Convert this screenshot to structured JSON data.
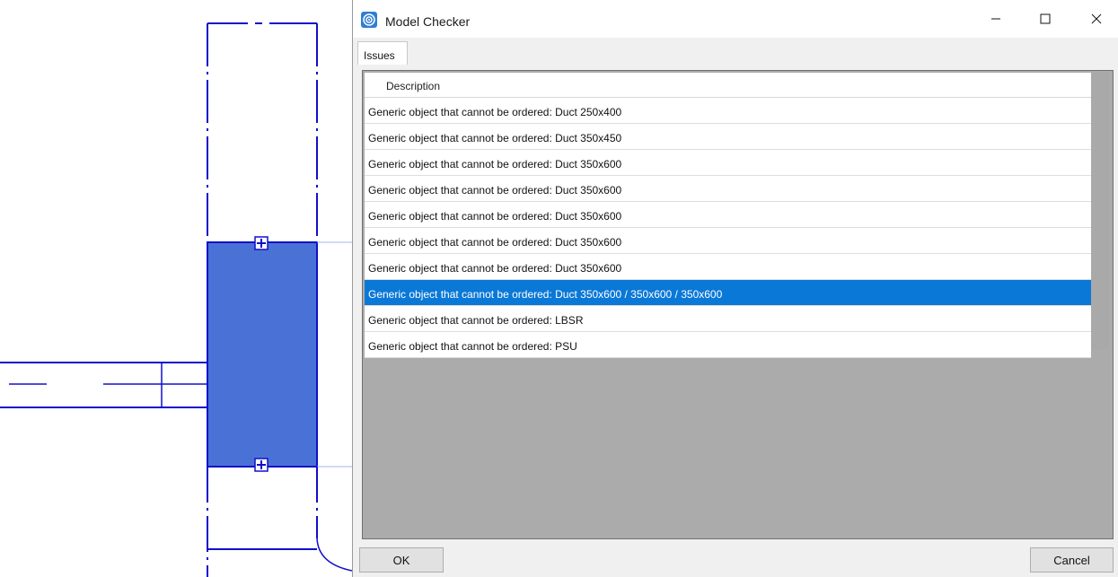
{
  "window": {
    "title": "Model Checker",
    "icon": "model-checker-app-icon",
    "controls": [
      "minimize-icon",
      "maximize-icon",
      "close-icon"
    ]
  },
  "tabs": [
    {
      "label": "Issues",
      "active": true
    }
  ],
  "grid": {
    "header": "Description",
    "selected_index": 7,
    "rows": [
      "Generic object that cannot be ordered: Duct 250x400",
      "Generic object that cannot be ordered: Duct 350x450",
      "Generic object that cannot be ordered: Duct 350x600",
      "Generic object that cannot be ordered: Duct 350x600",
      "Generic object that cannot be ordered: Duct 350x600",
      "Generic object that cannot be ordered: Duct 350x600",
      "Generic object that cannot be ordered: Duct 350x600",
      "Generic object that cannot be ordered: Duct 350x600 / 350x600 / 350x600",
      "Generic object that cannot be ordered: LBSR",
      "Generic object that cannot be ordered: PSU"
    ]
  },
  "buttons": {
    "ok": "OK",
    "cancel": "Cancel"
  },
  "colors": {
    "cad_line": "#1010cc",
    "cad_selection_fill": "#4a72d6",
    "selected_row": "#0a78d7",
    "panel_background": "#ababab"
  }
}
